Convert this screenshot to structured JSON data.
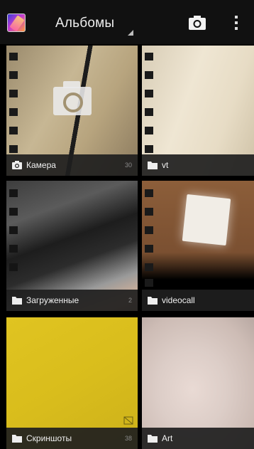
{
  "actionbar": {
    "title": "Альбомы",
    "camera_icon": "camera-icon",
    "overflow_icon": "overflow-menu-icon"
  },
  "albums": [
    {
      "name": "Камера",
      "count": "30",
      "type_icon": "camera-icon"
    },
    {
      "name": "vt",
      "count": "",
      "type_icon": "folder-icon"
    },
    {
      "name": "Загруженные",
      "count": "2",
      "type_icon": "folder-icon"
    },
    {
      "name": "videocall",
      "count": "",
      "type_icon": "folder-icon"
    },
    {
      "name": "Скриншоты",
      "count": "38",
      "type_icon": "folder-icon"
    },
    {
      "name": "Art",
      "count": "",
      "type_icon": "folder-icon"
    }
  ],
  "colors": {
    "actionbar_bg": "#111111",
    "label_bar_bg": "#1e1e1e",
    "accent_yellow": "#d9bd1c"
  }
}
